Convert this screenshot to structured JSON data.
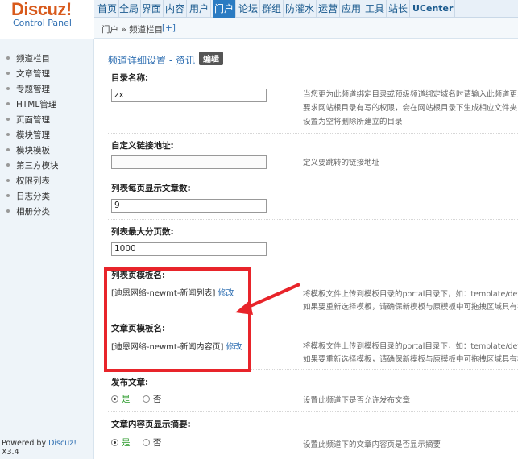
{
  "brand": {
    "logo": "Discuz!",
    "subtitle": "Control Panel"
  },
  "topnav": [
    {
      "label": "首页"
    },
    {
      "label": "全局"
    },
    {
      "label": "界面"
    },
    {
      "label": "内容"
    },
    {
      "label": "用户"
    },
    {
      "label": "门户"
    },
    {
      "label": "论坛"
    },
    {
      "label": "群组"
    },
    {
      "label": "防灌水"
    },
    {
      "label": "运营"
    },
    {
      "label": "应用"
    },
    {
      "label": "工具"
    },
    {
      "label": "站长"
    },
    {
      "label": "UCenter"
    }
  ],
  "breadcrumb": {
    "path": "门户 » 频道栏目",
    "add": "[+]"
  },
  "sidebar": {
    "items": [
      {
        "label": "频道栏目"
      },
      {
        "label": "文章管理"
      },
      {
        "label": "专题管理"
      },
      {
        "label": "HTML管理"
      },
      {
        "label": "页面管理"
      },
      {
        "label": "模块管理"
      },
      {
        "label": "模块模板"
      },
      {
        "label": "第三方模块"
      },
      {
        "label": "权限列表"
      },
      {
        "label": "日志分类"
      },
      {
        "label": "相册分类"
      }
    ],
    "powered": "Powered by",
    "powered_brand": "Discuz!",
    "version": "X3.4"
  },
  "page": {
    "title": "频道详细设置 - 资讯",
    "badge": "编辑"
  },
  "form": {
    "dir_name": {
      "label": "目录名称:",
      "value": "zx",
      "desc_lines": [
        "当您更为此频道绑定目录或预级频道绑定域名时请输入此频道更主",
        "要求网站根目录有写的权限，会在网站根目录下生成相应文件夹",
        "设置为空将删除所建立的目录"
      ]
    },
    "custom_link": {
      "label": "自定义链接地址:",
      "value": "",
      "desc": "定义要跳转的链接地址"
    },
    "per_page": {
      "label": "列表每页显示文章数:",
      "value": "9"
    },
    "max_pages": {
      "label": "列表最大分页数:",
      "value": "1000"
    },
    "list_tpl": {
      "label": "列表页模板名:",
      "value": "[迪恩网络-newmt-新闻列表]",
      "edit": "修改",
      "desc_lines": [
        "将模板文件上传到模板目录的portal目录下，如：template/default",
        "如果要重新选择模板，请确保新模板与原模板中可拖拽区域具有相"
      ]
    },
    "article_tpl": {
      "label": "文章页模板名:",
      "value": "[迪恩网络-newmt-新闻内容页]",
      "edit": "修改",
      "desc_lines": [
        "将模板文件上传到模板目录的portal目录下，如：template/defau",
        "如果要重新选择模板，请确保新模板与原模板中可拖拽区域具有相"
      ]
    },
    "publish": {
      "label": "发布文章:",
      "yes": "是",
      "no": "否",
      "desc": "设置此频道下是否允许发布文章"
    },
    "show_summary": {
      "label": "文章内容页显示摘要:",
      "yes": "是",
      "no": "否",
      "desc": "设置此频道下的文章内容页是否显示摘要"
    }
  },
  "colors": {
    "accent": "#2a7bc2",
    "brand_orange": "#d85a1c",
    "callout": "#e8242a"
  }
}
